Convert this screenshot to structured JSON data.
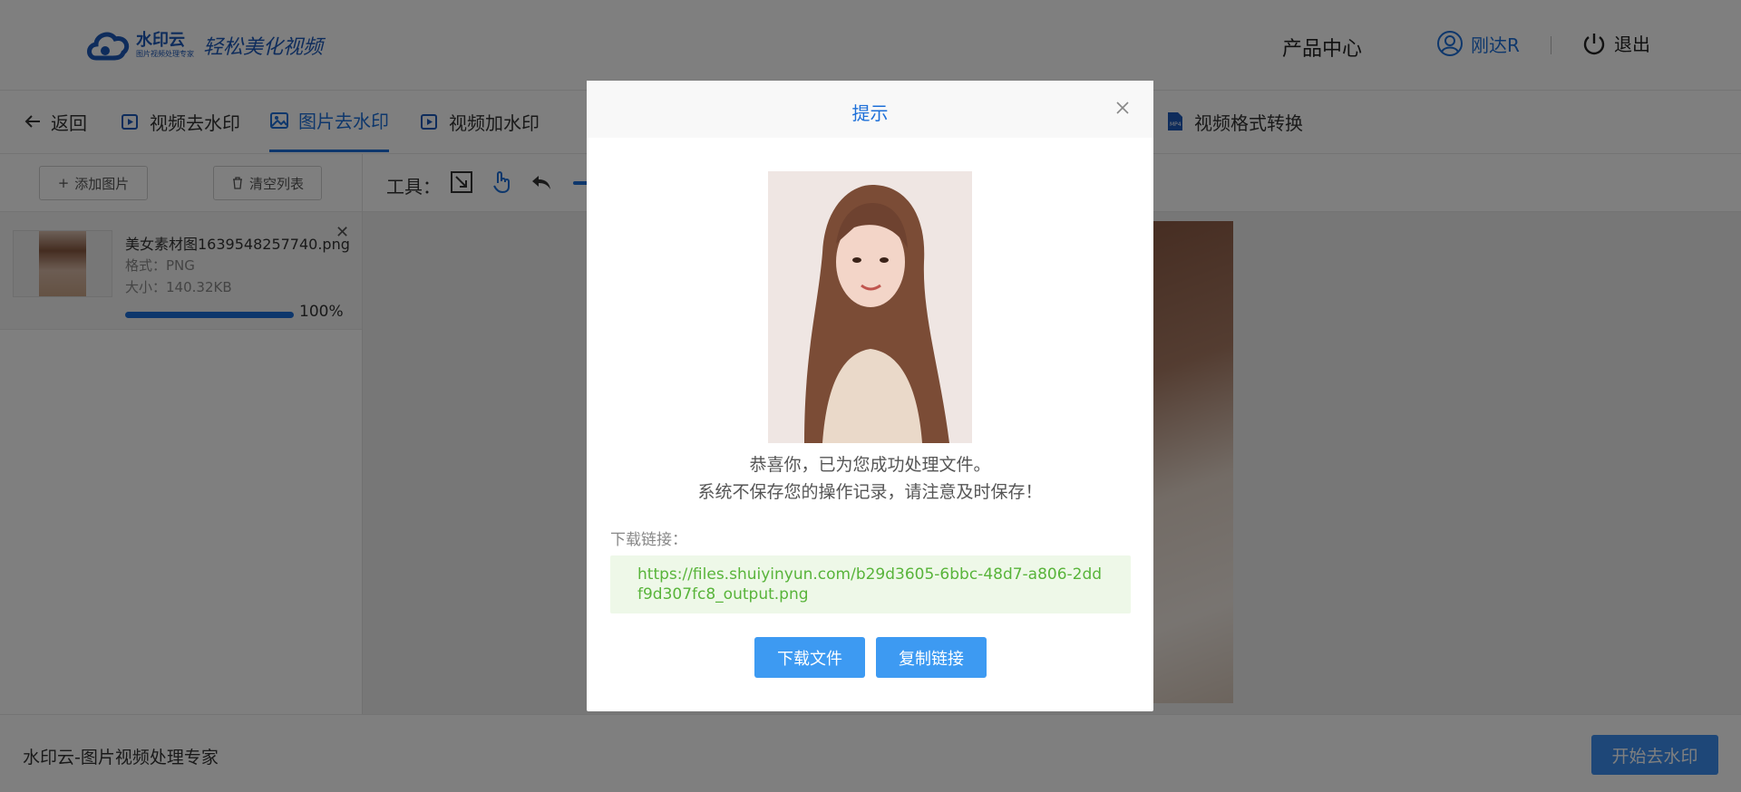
{
  "header": {
    "logo_name": "水印云",
    "logo_sub": "图片视频处理专家",
    "slogan": "轻松美化视频",
    "product_center": "产品中心",
    "username": "刚达R",
    "logout": "退出"
  },
  "tabs": [
    {
      "label": "返回",
      "icon": "arrow-left-icon"
    },
    {
      "label": "视频去水印",
      "icon": "video-icon"
    },
    {
      "label": "图片去水印",
      "icon": "image-icon",
      "active": true
    },
    {
      "label": "视频加水印",
      "icon": "video-icon"
    },
    {
      "label": "视频格式转换",
      "icon": "mp4-file-icon"
    }
  ],
  "left_panel": {
    "add_image": "添加图片",
    "clear_list": "清空列表",
    "file": {
      "name": "美女素材图1639548257740.png",
      "format": "格式：PNG",
      "size": "大小：140.32KB",
      "progress": 1.0,
      "progress_text": "100%"
    }
  },
  "toolbar": {
    "label": "工具："
  },
  "footer": {
    "brand": "水印云-图片视频处理专家",
    "start_button": "开始去水印"
  },
  "modal": {
    "title": "提示",
    "message_line1": "恭喜你，已为您成功处理文件。",
    "message_line2": "系统不保存您的操作记录，请注意及时保存！",
    "download_label": "下载链接：",
    "download_url": "https://files.shuiyinyun.com/b29d3605-6bbc-48d7-a806-2ddf9d307fc8_output.png",
    "download_button": "下载文件",
    "copy_button": "复制链接"
  },
  "colors": {
    "accent": "#1d6fd8",
    "button": "#3d9af2",
    "link_text": "#58b43a",
    "link_bg": "#eef8e8"
  }
}
